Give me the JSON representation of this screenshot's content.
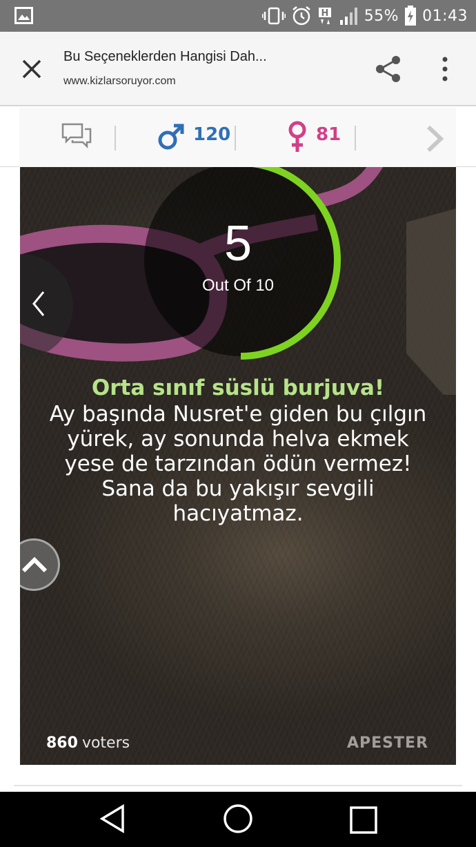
{
  "status_bar": {
    "battery": "55%",
    "time": "01:43",
    "icons": [
      "gallery-icon",
      "vibrate-icon",
      "alarm-icon",
      "h-network-icon",
      "signal-icon",
      "battery-icon"
    ]
  },
  "toolbar": {
    "title": "Bu Seçeneklerden Hangisi Dah...",
    "url": "www.kizlarsoruyor.com"
  },
  "stats": {
    "male_count": "120",
    "female_count": "81",
    "colors": {
      "male": "#2f6fb6",
      "female": "#d23f87"
    }
  },
  "quiz": {
    "score": "5",
    "score_label": "Out Of 10",
    "score_fraction": 0.5,
    "result_title": "Orta sınıf süslü burjuva!",
    "result_text": "Ay başında Nusret'e giden bu çılgın yürek, ay sonunda helva ekmek yese de tarzından ödün vermez! Sana da bu yakışır sevgili hacıyatmaz.",
    "voters_count": "860",
    "voters_label": "voters",
    "brand": "APESTER",
    "colors": {
      "progress": "#7ed321",
      "title": "#b6e38a"
    }
  }
}
